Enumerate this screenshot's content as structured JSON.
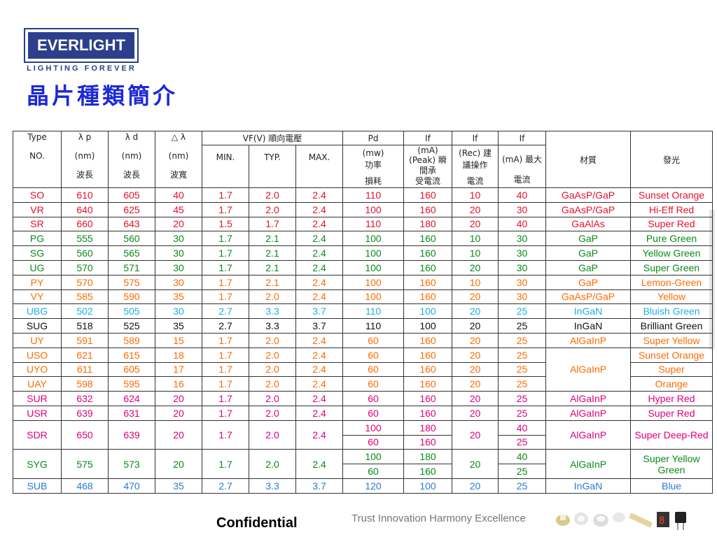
{
  "header": {
    "logo_text": "EVERLIGHT",
    "tagline": "LIGHTING FOREVER",
    "title": "晶片種類簡介"
  },
  "table": {
    "header": {
      "type": "Type",
      "no": "NO.",
      "lp": "λ p",
      "lp_unit": "(nm)",
      "lp_desc": "波長",
      "ld": "λ d",
      "ld_unit": "(nm)",
      "ld_desc": "波長",
      "dl": "△ λ",
      "dl_unit": "(nm)",
      "dl_desc": "波寬",
      "vf": "VF(V) 順向電壓",
      "vf_min": "MIN.",
      "vf_typ": "TYP.",
      "vf_max": "MAX.",
      "pd": "Pd",
      "pd_unit": "(mw)",
      "pd_desc1": "功率",
      "pd_desc2": "損耗",
      "if1": "If",
      "if1_unit": "(mA)",
      "if1_desc1": "(Peak) 瞬",
      "if1_desc2": "間承",
      "if1_desc3": "受電流",
      "if2": "If",
      "if2_desc1": "(Rec) 建",
      "if2_desc2": "議操作",
      "if2_desc3": "電流",
      "if3": "If",
      "if3_desc1": "(mA) 最大",
      "if3_desc2": "電流",
      "material": "材質",
      "emission": "發光"
    },
    "rows": [
      {
        "type": "SO",
        "lp": "610",
        "ld": "605",
        "dl": "40",
        "min": "1.7",
        "typ": "2.0",
        "max": "2.4",
        "pd": "110",
        "ifp": "160",
        "ifr": "10",
        "ifm": "40",
        "material": "GaAsP/GaP",
        "emission": "Sunset Orange",
        "color": "red"
      },
      {
        "type": "VR",
        "lp": "640",
        "ld": "625",
        "dl": "45",
        "min": "1.7",
        "typ": "2.0",
        "max": "2.4",
        "pd": "100",
        "ifp": "160",
        "ifr": "20",
        "ifm": "30",
        "material": "GaAsP/GaP",
        "emission": "Hi-Eff Red",
        "color": "red"
      },
      {
        "type": "SR",
        "lp": "660",
        "ld": "643",
        "dl": "20",
        "min": "1.5",
        "typ": "1.7",
        "max": "2.4",
        "pd": "110",
        "ifp": "180",
        "ifr": "20",
        "ifm": "40",
        "material": "GaAlAs",
        "emission": "Super Red",
        "color": "red"
      },
      {
        "type": "PG",
        "lp": "555",
        "ld": "560",
        "dl": "30",
        "min": "1.7",
        "typ": "2.1",
        "max": "2.4",
        "pd": "100",
        "ifp": "160",
        "ifr": "10",
        "ifm": "30",
        "material": "GaP",
        "emission": "Pure Green",
        "color": "green"
      },
      {
        "type": "SG",
        "lp": "560",
        "ld": "565",
        "dl": "30",
        "min": "1.7",
        "typ": "2.1",
        "max": "2.4",
        "pd": "100",
        "ifp": "160",
        "ifr": "10",
        "ifm": "30",
        "material": "GaP",
        "emission": "Yellow Green",
        "color": "green"
      },
      {
        "type": "UG",
        "lp": "570",
        "ld": "571",
        "dl": "30",
        "min": "1.7",
        "typ": "2.1",
        "max": "2.4",
        "pd": "100",
        "ifp": "160",
        "ifr": "20",
        "ifm": "30",
        "material": "GaP",
        "emission": "Super Green",
        "color": "green"
      },
      {
        "type": "PY",
        "lp": "570",
        "ld": "575",
        "dl": "30",
        "min": "1.7",
        "typ": "2.1",
        "max": "2.4",
        "pd": "100",
        "ifp": "160",
        "ifr": "10",
        "ifm": "30",
        "material": "GaP",
        "emission": "Lemon-Green",
        "color": "orange"
      },
      {
        "type": "VY",
        "lp": "585",
        "ld": "590",
        "dl": "35",
        "min": "1.7",
        "typ": "2.0",
        "max": "2.4",
        "pd": "100",
        "ifp": "160",
        "ifr": "20",
        "ifm": "30",
        "material": "GaAsP/GaP",
        "emission": "Yellow",
        "color": "orange"
      },
      {
        "type": "UBG",
        "lp": "502",
        "ld": "505",
        "dl": "30",
        "min": "2.7",
        "typ": "3.3",
        "max": "3.7",
        "pd": "110",
        "ifp": "100",
        "ifr": "20",
        "ifm": "25",
        "material": "InGaN",
        "emission": "Bluish Green",
        "color": "cyan"
      },
      {
        "type": "SUG",
        "lp": "518",
        "ld": "525",
        "dl": "35",
        "min": "2.7",
        "typ": "3.3",
        "max": "3.7",
        "pd": "110",
        "ifp": "100",
        "ifr": "20",
        "ifm": "25",
        "material": "InGaN",
        "emission": "Brilliant Green",
        "color": "black"
      },
      {
        "type": "UY",
        "lp": "591",
        "ld": "589",
        "dl": "15",
        "min": "1.7",
        "typ": "2.0",
        "max": "2.4",
        "pd": "60",
        "ifp": "160",
        "ifr": "20",
        "ifm": "25",
        "material": "AlGaInP",
        "emission": "Super Yellow",
        "color": "orange"
      },
      {
        "type": "USO",
        "lp": "621",
        "ld": "615",
        "dl": "18",
        "min": "1.7",
        "typ": "2.0",
        "max": "2.4",
        "pd": "60",
        "ifp": "160",
        "ifr": "20",
        "ifm": "25",
        "material": "",
        "emission": "Sunset Orange",
        "color": "orange"
      },
      {
        "type": "UYO",
        "lp": "611",
        "ld": "605",
        "dl": "17",
        "min": "1.7",
        "typ": "2.0",
        "max": "2.4",
        "pd": "60",
        "ifp": "160",
        "ifr": "20",
        "ifm": "25",
        "material": "AlGaInP",
        "emission": "Super",
        "color": "orange"
      },
      {
        "type": "UAY",
        "lp": "598",
        "ld": "595",
        "dl": "16",
        "min": "1.7",
        "typ": "2.0",
        "max": "2.4",
        "pd": "60",
        "ifp": "160",
        "ifr": "20",
        "ifm": "25",
        "material": "",
        "emission": "Orange",
        "color": "orange"
      },
      {
        "type": "SUR",
        "lp": "632",
        "ld": "624",
        "dl": "20",
        "min": "1.7",
        "typ": "2.0",
        "max": "2.4",
        "pd": "60",
        "ifp": "160",
        "ifr": "20",
        "ifm": "25",
        "material": "AlGaInP",
        "emission": "Hyper Red",
        "color": "magenta"
      },
      {
        "type": "USR",
        "lp": "639",
        "ld": "631",
        "dl": "20",
        "min": "1.7",
        "typ": "2.0",
        "max": "2.4",
        "pd": "60",
        "ifp": "160",
        "ifr": "20",
        "ifm": "25",
        "material": "AlGaInP",
        "emission": "Super Red",
        "color": "magenta"
      }
    ],
    "sdr": {
      "type": "SDR",
      "lp": "650",
      "ld": "639",
      "dl": "20",
      "min": "1.7",
      "typ": "2.0",
      "max": "2.4",
      "pd_a": "100",
      "pd_b": "60",
      "ifp_a": "180",
      "ifp_b": "160",
      "ifr": "20",
      "ifm_a": "40",
      "ifm_b": "25",
      "material": "AlGaInP",
      "emission": "Super Deep-Red"
    },
    "syg": {
      "type": "SYG",
      "lp": "575",
      "ld": "573",
      "dl": "20",
      "min": "1.7",
      "typ": "2.0",
      "max": "2.4",
      "pd_a": "100",
      "pd_b": "60",
      "ifp_a": "180",
      "ifp_b": "160",
      "ifr": "20",
      "ifm_a": "40",
      "ifm_b": "25",
      "material": "AlGaInP",
      "emission": "Super Yellow Green"
    },
    "sub": {
      "type": "SUB",
      "lp": "468",
      "ld": "470",
      "dl": "35",
      "min": "2.7",
      "typ": "3.3",
      "max": "3.7",
      "pd": "120",
      "ifp": "100",
      "ifr": "20",
      "ifm": "25",
      "material": "InGaN",
      "emission": "Blue"
    }
  },
  "footer": {
    "confidential": "Confidential",
    "motto": "Trust Innovation Harmony Excellence"
  }
}
